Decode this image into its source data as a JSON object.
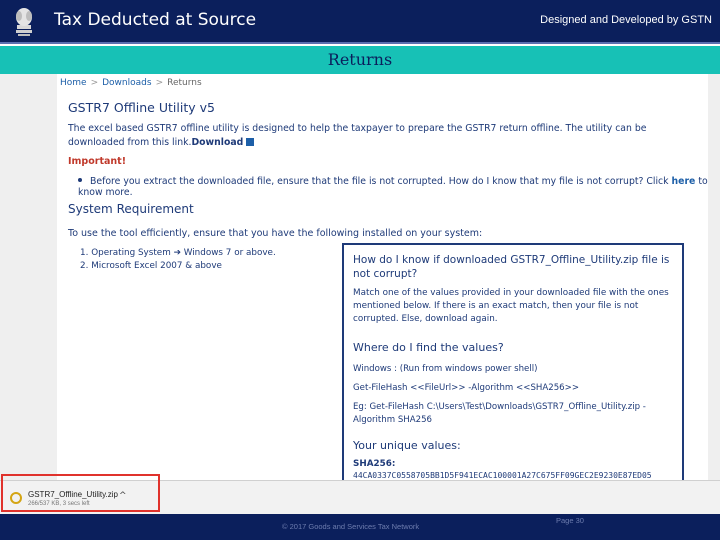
{
  "header": {
    "title": "Tax Deducted at Source",
    "credit": "Designed and Developed by GSTN",
    "emblem_icon": "national-emblem-icon"
  },
  "section": {
    "title": "Returns"
  },
  "page": {
    "breadcrumb": [
      "Home",
      "Downloads",
      "Returns"
    ],
    "title": "GSTR7 Offline Utility v5",
    "intro": "The excel based GSTR7 offline utility is designed to help the taxpayer to prepare the GSTR7 return offline. The utility can be downloaded from this link.",
    "download_label": "Download",
    "important_label": "Important!",
    "important_text": "Before you extract the downloaded file, ensure that the file is not corrupted. How do I know that my file is not corrupt? Click",
    "here_label": "here",
    "important_tail": "to know more.",
    "sysreq_title": "System Requirement",
    "sysreq_lead": "To use the tool efficiently, ensure that you have the following installed on your system:",
    "requirements": [
      "1. Operating System ➔ Windows 7 or above.",
      "2. Microsoft Excel 2007 & above"
    ]
  },
  "panel": {
    "heading": "How do I know if downloaded GSTR7_Offline_Utility.zip file is not corrupt?",
    "body": "Match one of the values provided in your downloaded file with the ones mentioned below. If there is an exact match, then your file is not corrupted. Else, download again.",
    "find_heading": "Where do I find the values?",
    "windows_line": "Windows : (Run from windows power shell)",
    "cmd_line": "Get-FileHash <<FileUrl>> -Algorithm <<SHA256>>",
    "eg_line": "Eg: Get-FileHash C:\\Users\\Test\\Downloads\\GSTR7_Offline_Utility.zip -Algorithm SHA256",
    "unique_heading": "Your unique values:",
    "hash_label": "SHA256:",
    "hash_value": "44CA0337C0558705BB1D5F941ECAC100001A27C675FF09GEC2E9230E87ED05"
  },
  "downloads": {
    "file_name": "GSTR7_Offline_Utility.zip",
    "progress": "266/537 KB, 3 secs left",
    "file_icon": "download-progress-icon",
    "menu_icon": "chevron-up-icon"
  },
  "footer": {
    "copyright": "© 2017 Goods and Services Tax Network",
    "page_label": "Page 30"
  },
  "colors": {
    "header_bg": "#0b1f5c",
    "section_band": "#17c1b6",
    "text_blue": "#1e3a78",
    "highlight_red": "#e0322c"
  }
}
